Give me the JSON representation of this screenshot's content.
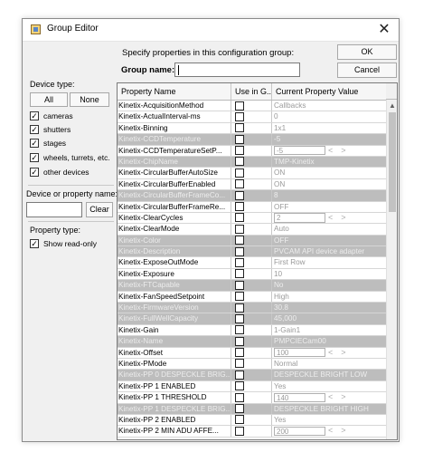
{
  "window": {
    "title": "Group Editor",
    "close_glyph": "✕"
  },
  "header": {
    "instruction": "Specify properties in this configuration group:",
    "group_name_label": "Group name:",
    "group_name_value": "",
    "ok_label": "OK",
    "cancel_label": "Cancel"
  },
  "sidebar": {
    "device_type_label": "Device type:",
    "all_label": "All",
    "none_label": "None",
    "device_types": [
      {
        "label": "cameras",
        "checked": true
      },
      {
        "label": "shutters",
        "checked": true
      },
      {
        "label": "stages",
        "checked": true
      },
      {
        "label": "wheels, turrets, etc.",
        "checked": true
      },
      {
        "label": "other devices",
        "checked": true
      }
    ],
    "filter_label": "Device or property name:",
    "filter_value": "",
    "clear_label": "Clear",
    "property_type_label": "Property type:",
    "show_read_only_label": "Show read-only",
    "show_read_only_checked": true
  },
  "table": {
    "headers": [
      "Property Name",
      "Use in G...",
      "Current Property Value"
    ],
    "rows": [
      {
        "name": "Kinetix-AcquisitionMethod",
        "value": "Callbacks",
        "ro": false,
        "spinner": false
      },
      {
        "name": "Kinetix-ActualInterval-ms",
        "value": "0",
        "ro": false,
        "spinner": false
      },
      {
        "name": "Kinetix-Binning",
        "value": "1x1",
        "ro": false,
        "spinner": false
      },
      {
        "name": "Kinetix-CCDTemperature",
        "value": "-5",
        "ro": true,
        "spinner": false
      },
      {
        "name": "Kinetix-CCDTemperatureSetP...",
        "value": "-5",
        "ro": false,
        "spinner": true
      },
      {
        "name": "Kinetix-ChipName",
        "value": "TMP-Kinetix",
        "ro": true,
        "spinner": false
      },
      {
        "name": "Kinetix-CircularBufferAutoSize",
        "value": "ON",
        "ro": false,
        "spinner": false
      },
      {
        "name": "Kinetix-CircularBufferEnabled",
        "value": "ON",
        "ro": false,
        "spinner": false
      },
      {
        "name": "Kinetix-CircularBufferFrameCo...",
        "value": "8",
        "ro": true,
        "spinner": false
      },
      {
        "name": "Kinetix-CircularBufferFrameRe...",
        "value": "OFF",
        "ro": false,
        "spinner": false
      },
      {
        "name": "Kinetix-ClearCycles",
        "value": "2",
        "ro": false,
        "spinner": true
      },
      {
        "name": "Kinetix-ClearMode",
        "value": "Auto",
        "ro": false,
        "spinner": false
      },
      {
        "name": "Kinetix-Color",
        "value": "OFF",
        "ro": true,
        "spinner": false
      },
      {
        "name": "Kinetix-Description",
        "value": "PVCAM API device adapter",
        "ro": true,
        "spinner": false
      },
      {
        "name": "Kinetix-ExposeOutMode",
        "value": "First Row",
        "ro": false,
        "spinner": false
      },
      {
        "name": "Kinetix-Exposure",
        "value": "10",
        "ro": false,
        "spinner": false
      },
      {
        "name": "Kinetix-FTCapable",
        "value": "No",
        "ro": true,
        "spinner": false
      },
      {
        "name": "Kinetix-FanSpeedSetpoint",
        "value": "High",
        "ro": false,
        "spinner": false
      },
      {
        "name": "Kinetix-FirmwareVersion",
        "value": "30.8",
        "ro": true,
        "spinner": false
      },
      {
        "name": "Kinetix-FullWellCapacity",
        "value": "45,000",
        "ro": true,
        "spinner": false
      },
      {
        "name": "Kinetix-Gain",
        "value": "1-Gain1",
        "ro": false,
        "spinner": false
      },
      {
        "name": "Kinetix-Name",
        "value": "PMPCIECam00",
        "ro": true,
        "spinner": false
      },
      {
        "name": "Kinetix-Offset",
        "value": "100",
        "ro": false,
        "spinner": true
      },
      {
        "name": "Kinetix-PMode",
        "value": "Normal",
        "ro": false,
        "spinner": false
      },
      {
        "name": "Kinetix-PP  0 DESPECKLE BRIG...",
        "value": "DESPECKLE BRIGHT LOW",
        "ro": true,
        "spinner": false
      },
      {
        "name": "Kinetix-PP  1  ENABLED",
        "value": "Yes",
        "ro": false,
        "spinner": false
      },
      {
        "name": "Kinetix-PP  1  THRESHOLD",
        "value": "140",
        "ro": false,
        "spinner": true
      },
      {
        "name": "Kinetix-PP  1 DESPECKLE BRIG...",
        "value": "DESPECKLE BRIGHT HIGH",
        "ro": true,
        "spinner": false
      },
      {
        "name": "Kinetix-PP  2  ENABLED",
        "value": "Yes",
        "ro": false,
        "spinner": false
      },
      {
        "name": "Kinetix-PP  2  MIN ADU AFFE...",
        "value": "200",
        "ro": false,
        "spinner": true
      }
    ]
  },
  "icons": {
    "app": "group-editor-app-icon",
    "close": "close-icon"
  }
}
